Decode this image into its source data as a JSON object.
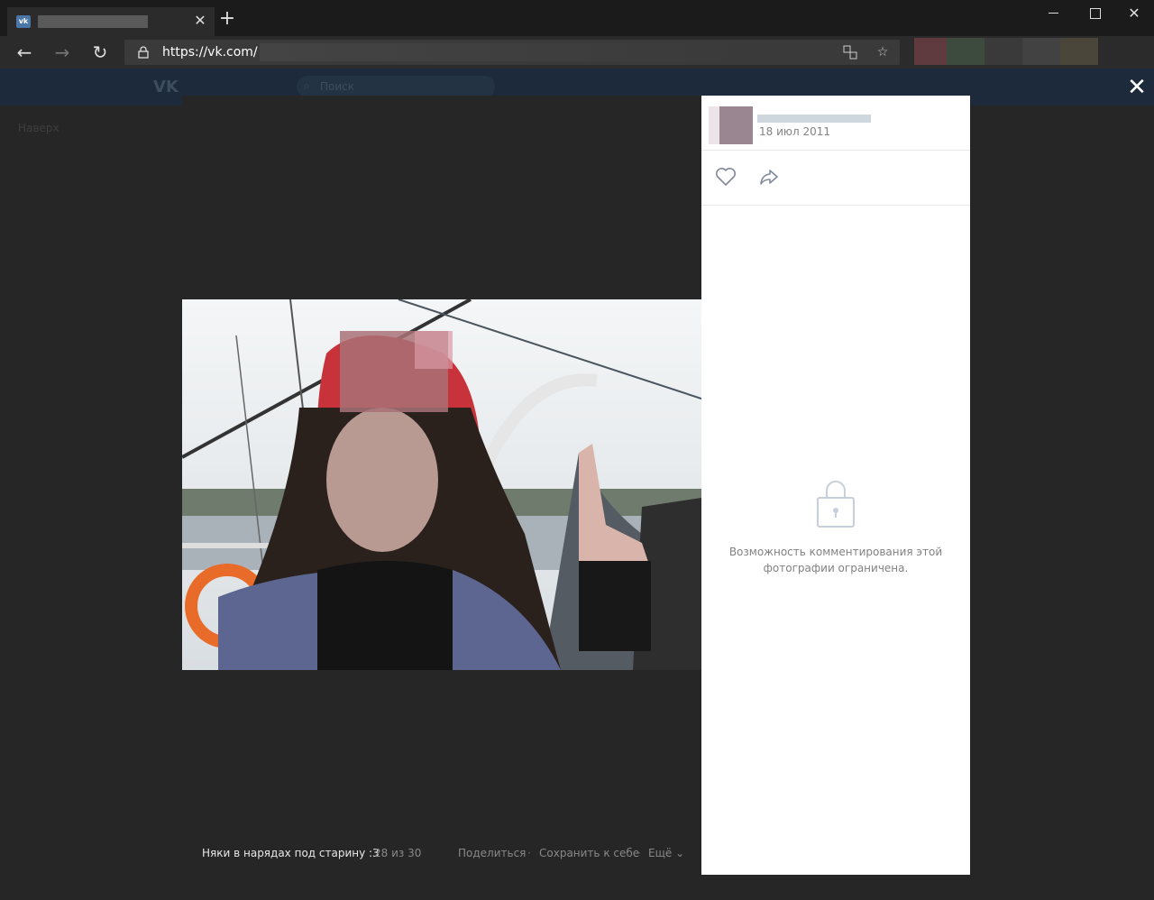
{
  "browser": {
    "url": "https://vk.com/",
    "tab_close": "✕",
    "new_tab": "+",
    "back": "←",
    "forward": "→",
    "reload": "↻",
    "close_window": "✕"
  },
  "vk": {
    "logo": "VK",
    "search_placeholder": "Поиск",
    "back_to_top": "Наверх"
  },
  "viewer": {
    "close": "✕",
    "date": "18 июл 2011",
    "album": "Няки в нарядах под старину :3",
    "counter": "28 из 30",
    "share": "Поделиться",
    "separator": "·",
    "save": "Сохранить к себе",
    "more": "Ещё ⌄",
    "comments_restricted": "Возможность комментирования этой фотографии ограничена."
  },
  "colors": {
    "vk_blue": "#4a76a8",
    "overlay_bg": "#262626",
    "side_bg": "#ffffff",
    "muted_text": "#828282"
  }
}
